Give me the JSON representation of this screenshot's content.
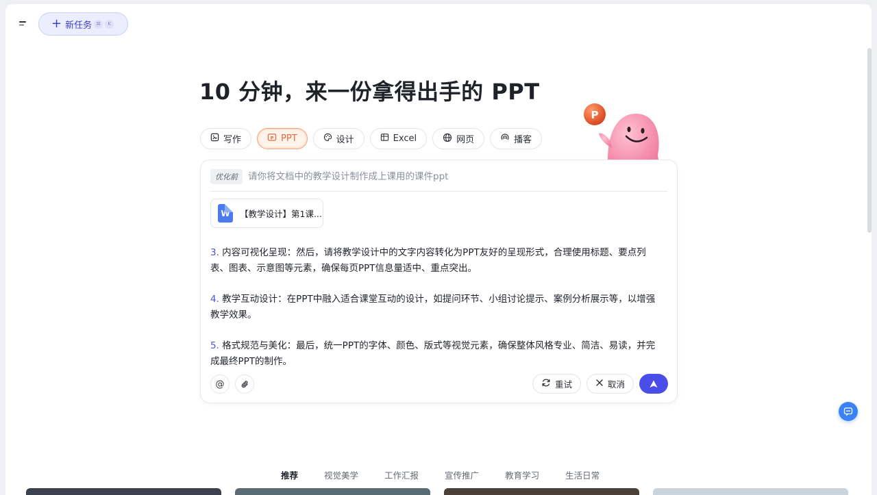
{
  "header": {
    "new_task_label": "新任务",
    "shortcut_keys": [
      "⌘",
      "K"
    ]
  },
  "headline": "10 分钟，来一份拿得出手的 PPT",
  "mode_tabs": [
    {
      "label": "写作",
      "icon": "edit-image-icon"
    },
    {
      "label": "PPT",
      "icon": "ppt-icon",
      "active": true
    },
    {
      "label": "设计",
      "icon": "palette-icon"
    },
    {
      "label": "Excel",
      "icon": "table-icon"
    },
    {
      "label": "网页",
      "icon": "globe-icon"
    },
    {
      "label": "播客",
      "icon": "podcast-icon"
    }
  ],
  "prompt": {
    "tag": "优化前",
    "text": "请你将文档中的教学设计制作成上课用的课件ppt"
  },
  "attachment": {
    "file_icon_letter": "W",
    "file_name": "【教学设计】第1课..."
  },
  "steps": [
    {
      "num": "3.",
      "text": " 内容可视化呈现：然后，请将教学设计中的文字内容转化为PPT友好的呈现形式，合理使用标题、要点列表、图表、示意图等元素，确保每页PPT信息量适中、重点突出。"
    },
    {
      "num": "4.",
      "text": " 教学互动设计：在PPT中融入适合课堂互动的设计，如提问环节、小组讨论提示、案例分析展示等，以增强教学效果。"
    },
    {
      "num": "5.",
      "text": " 格式规范与美化：最后，统一PPT的字体、颜色、版式等视觉元素，确保整体风格专业、简洁、易读，并完成最终PPT的制作。"
    }
  ],
  "actions": {
    "retry_label": "重试",
    "cancel_label": "取消"
  },
  "mascot_badge": "P",
  "categories": [
    {
      "label": "推荐",
      "active": true
    },
    {
      "label": "视觉美学"
    },
    {
      "label": "工作汇报"
    },
    {
      "label": "宣传推广"
    },
    {
      "label": "教育学习"
    },
    {
      "label": "生活日常"
    }
  ],
  "colors": {
    "accent": "#4a4ee8",
    "ppt_orange": "#e8643a",
    "float_blue": "#3b82f6"
  }
}
